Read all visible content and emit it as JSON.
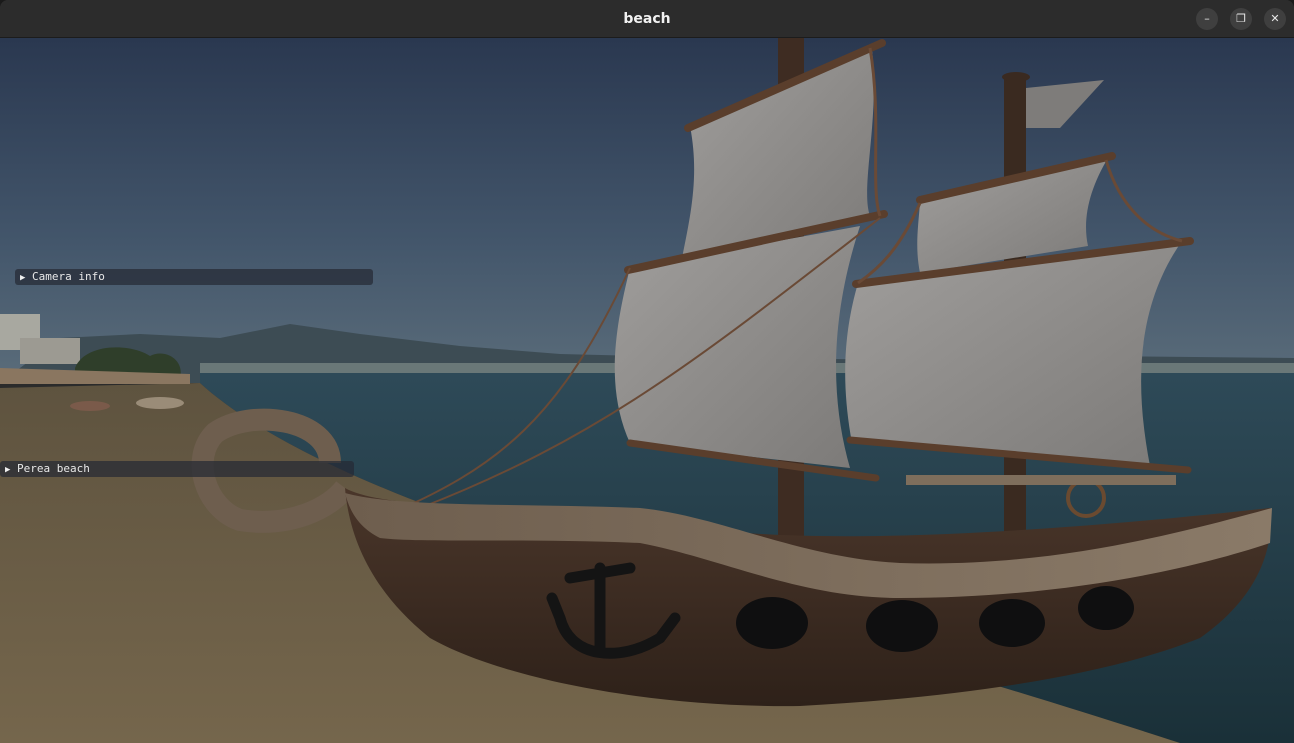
{
  "window": {
    "title": "beach",
    "controls": {
      "minimize_glyph": "–",
      "maximize_glyph": "❐",
      "close_glyph": "✕"
    }
  },
  "overlay": {
    "camera_info": {
      "arrow": "▶",
      "label": "Camera info",
      "expanded": false
    },
    "scene_panel": {
      "arrow": "▶",
      "label": "Perea beach",
      "expanded": false
    }
  },
  "colors": {
    "sky_top": "#2c3a4f",
    "sky_bottom": "#52677a",
    "sea": "#1f3a45",
    "sand": "#6e6048",
    "sail": "#8e8e8e",
    "hull_dark": "#3a2a20",
    "hull_light": "#7a6a58",
    "panel_bg": "#262a34"
  }
}
